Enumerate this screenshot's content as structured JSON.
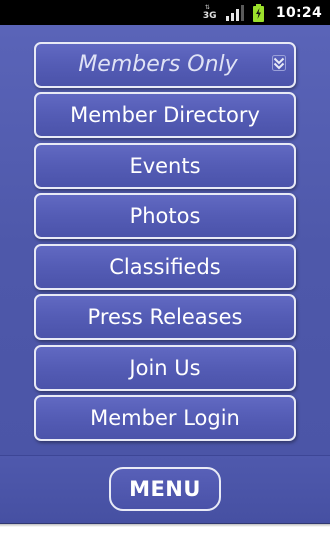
{
  "status_bar": {
    "network_type": "3G",
    "time": "10:24",
    "icons": [
      "data-transfer-icon",
      "signal-strength-icon",
      "battery-charging-icon"
    ]
  },
  "menu": {
    "dropdown": {
      "label": "Members Only",
      "icon": "chevron-down-icon"
    },
    "items": [
      {
        "label": "Member Directory"
      },
      {
        "label": "Events"
      },
      {
        "label": "Photos"
      },
      {
        "label": "Classifieds"
      },
      {
        "label": "Press Releases"
      },
      {
        "label": "Join Us"
      },
      {
        "label": "Member Login"
      }
    ]
  },
  "bottom_bar": {
    "menu_label": "MENU"
  },
  "colors": {
    "background": "#4e58aa",
    "button_fill": "#545cb5",
    "button_border": "#e8eaf6",
    "status_bar": "#000000",
    "battery": "#9be02b"
  }
}
